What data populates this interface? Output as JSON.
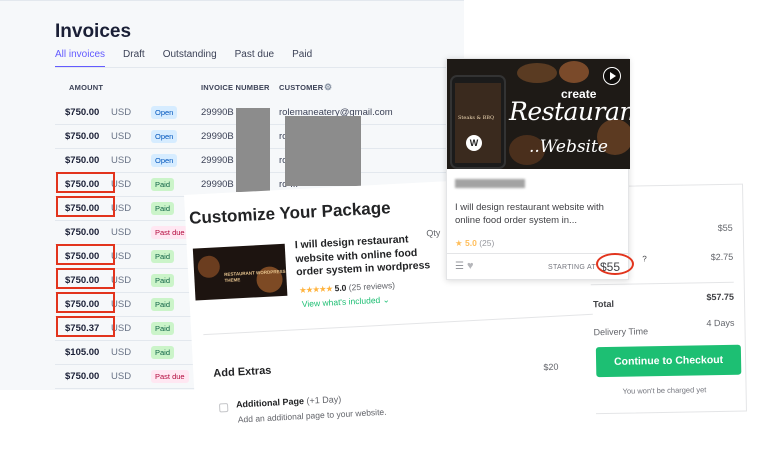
{
  "invoices": {
    "title": "Invoices",
    "tabs": [
      "All invoices",
      "Draft",
      "Outstanding",
      "Past due",
      "Paid"
    ],
    "columns": {
      "amount": "AMOUNT",
      "invoice_number": "INVOICE NUMBER",
      "customer": "CUSTOMER"
    },
    "rows": [
      {
        "amount": "$750.00",
        "currency": "USD",
        "status": "Open",
        "number": "29990B",
        "customer": "rolemaneatery@gmail.com"
      },
      {
        "amount": "$750.00",
        "currency": "USD",
        "status": "Open",
        "number": "29990B",
        "customer": "ro .com"
      },
      {
        "amount": "$750.00",
        "currency": "USD",
        "status": "Open",
        "number": "29990B",
        "customer": "ro .com"
      },
      {
        "amount": "$750.00",
        "currency": "USD",
        "status": "Paid",
        "number": "29990B",
        "customer": "ro ..."
      },
      {
        "amount": "$750.00",
        "currency": "USD",
        "status": "Paid",
        "number": "",
        "customer": ""
      },
      {
        "amount": "$750.00",
        "currency": "USD",
        "status": "Past due",
        "number": "",
        "customer": ""
      },
      {
        "amount": "$750.00",
        "currency": "USD",
        "status": "Paid",
        "number": "",
        "customer": ""
      },
      {
        "amount": "$750.00",
        "currency": "USD",
        "status": "Paid",
        "number": "",
        "customer": ""
      },
      {
        "amount": "$750.00",
        "currency": "USD",
        "status": "Paid",
        "number": "",
        "customer": ""
      },
      {
        "amount": "$750.37",
        "currency": "USD",
        "status": "Paid",
        "number": "",
        "customer": ""
      },
      {
        "amount": "$105.00",
        "currency": "USD",
        "status": "Paid",
        "number": "",
        "customer": ""
      },
      {
        "amount": "$750.00",
        "currency": "USD",
        "status": "Past due",
        "number": "",
        "customer": ""
      }
    ]
  },
  "gig": {
    "image_text": {
      "create": "create",
      "restaurant": "Restaurant",
      "website": "..Website",
      "phone_label": "Steaks & BBQ",
      "wp": "W"
    },
    "description": "I will design restaurant website with online food order system in...",
    "rating": "5.0",
    "reviews": "(25)",
    "starting_at": "STARTING AT",
    "price": "$55"
  },
  "package": {
    "title": "Customize Your Package",
    "thumb_caption": "RESTAURANT WORDPRESS THEME",
    "gig_name": "I will design restaurant website with online food order system in wordpress",
    "qty_label": "Qty",
    "rating": "5.0",
    "reviews": "(25 reviews)",
    "view_included": "View what's included",
    "extras_title": "Add Extras",
    "extra": {
      "name": "Additional Page",
      "days": "(+1 Day)",
      "description": "Add an additional page to your website.",
      "price": "$20"
    }
  },
  "checkout": {
    "subtotal": "$55",
    "service_fee": "$2.75",
    "total_label": "Total",
    "total": "$57.75",
    "delivery_label": "Delivery Time",
    "delivery": "4 Days",
    "button": "Continue to Checkout",
    "note": "You won't be charged yet"
  },
  "colors": {
    "accent": "#635bff",
    "green": "#1dbf73",
    "highlight": "#e2341d"
  }
}
